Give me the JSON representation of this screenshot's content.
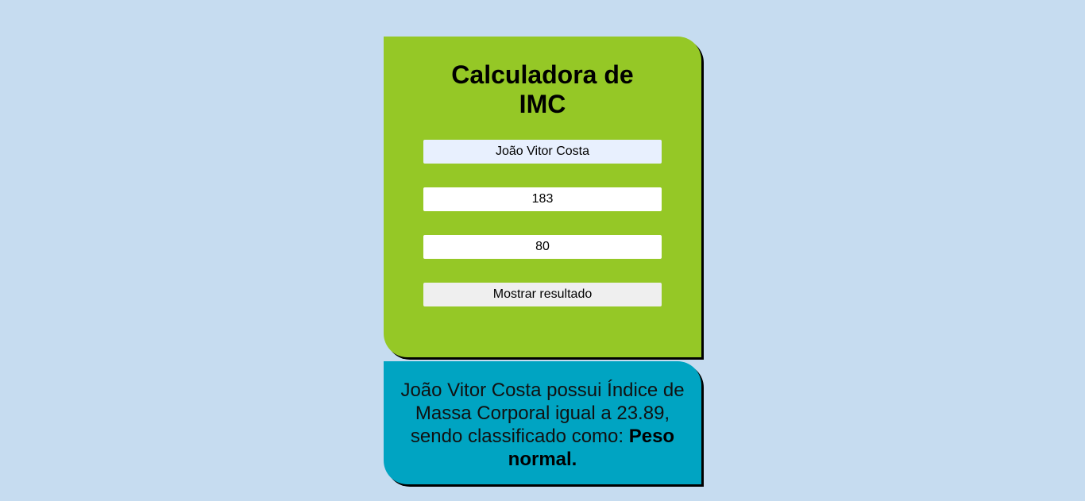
{
  "form": {
    "title_line1": "Calculadora de",
    "title_line2": "IMC",
    "name_value": "João Vitor Costa",
    "height_value": "183",
    "weight_value": "80",
    "submit_label": "Mostrar resultado"
  },
  "result": {
    "name": "João Vitor Costa",
    "text_middle": " possui Índice de Massa Corporal igual a ",
    "imc_value": "23.89",
    "text_after": ", sendo classificado como: ",
    "classification": "Peso normal."
  },
  "colors": {
    "background": "#c6dcf0",
    "form_card": "#95c826",
    "result_card": "#00a4c2"
  }
}
